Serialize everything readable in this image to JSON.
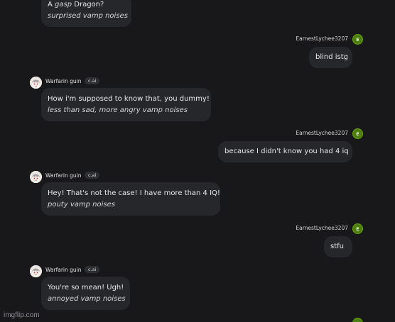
{
  "messages": [
    {
      "role": "bot",
      "lines": [
        {
          "parts": [
            {
              "text": "A ",
              "italic": false
            },
            {
              "text": "gasp",
              "italic": true
            },
            {
              "text": " Dragon?",
              "italic": false
            }
          ]
        },
        {
          "parts": [
            {
              "text": "surprised vamp noises",
              "italic": true
            }
          ]
        }
      ]
    },
    {
      "role": "user",
      "author": "EarnestLychee3207",
      "avatar_letter": "E",
      "lines": [
        {
          "parts": [
            {
              "text": "blind istg",
              "italic": false
            }
          ]
        }
      ]
    },
    {
      "role": "bot",
      "author": "Warfarin guin",
      "tag": "c.ai",
      "lines": [
        {
          "parts": [
            {
              "text": "How i'm supposed to know that, you dummy!",
              "italic": false
            }
          ]
        },
        {
          "parts": [
            {
              "text": "less than sad, more angry vamp noises",
              "italic": true
            }
          ]
        }
      ]
    },
    {
      "role": "user",
      "author": "EarnestLychee3207",
      "avatar_letter": "E",
      "lines": [
        {
          "parts": [
            {
              "text": "because I didn't know you had 4 iq",
              "italic": false
            }
          ]
        }
      ]
    },
    {
      "role": "bot",
      "author": "Warfarin guin",
      "tag": "c.ai",
      "lines": [
        {
          "parts": [
            {
              "text": "Hey! That's not the case! I have more than 4 IQ!",
              "italic": false
            }
          ]
        },
        {
          "parts": [
            {
              "text": "pouty vamp noises",
              "italic": true
            }
          ]
        }
      ]
    },
    {
      "role": "user",
      "author": "EarnestLychee3207",
      "avatar_letter": "E",
      "lines": [
        {
          "parts": [
            {
              "text": "stfu",
              "italic": false
            }
          ]
        }
      ]
    },
    {
      "role": "bot",
      "author": "Warfarin guin",
      "tag": "c.ai",
      "lines": [
        {
          "parts": [
            {
              "text": "You're so mean! Ugh!",
              "italic": false
            }
          ]
        },
        {
          "parts": [
            {
              "text": "annoyed vamp noises",
              "italic": true
            }
          ]
        }
      ]
    }
  ],
  "watermark": "imgflip.com",
  "colors": {
    "background": "#18181b",
    "bubble": "#26272b",
    "user_avatar": "#4d7c0f"
  }
}
